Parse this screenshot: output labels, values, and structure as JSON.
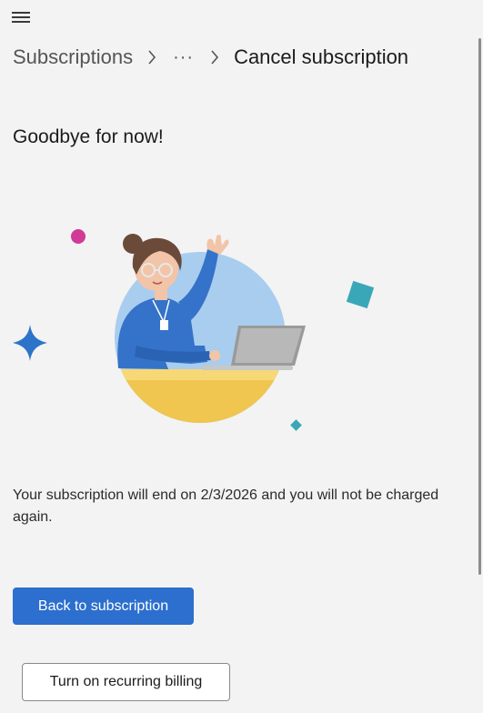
{
  "header": {
    "menu_icon": "hamburger-menu-icon"
  },
  "breadcrumb": {
    "items": [
      "Subscriptions",
      "···",
      "Cancel subscription"
    ],
    "separator_icon": "chevron-right-icon"
  },
  "main": {
    "title": "Goodbye for now!",
    "illustration": "woman-waving-at-laptop-illustration",
    "message": "Your subscription will end on 2/3/2026 and you will not be charged again.",
    "primary_button_label": "Back to subscription",
    "secondary_button_label": "Turn on recurring billing"
  },
  "colors": {
    "background": "#f3f3f3",
    "accent": "#2c6fce"
  }
}
